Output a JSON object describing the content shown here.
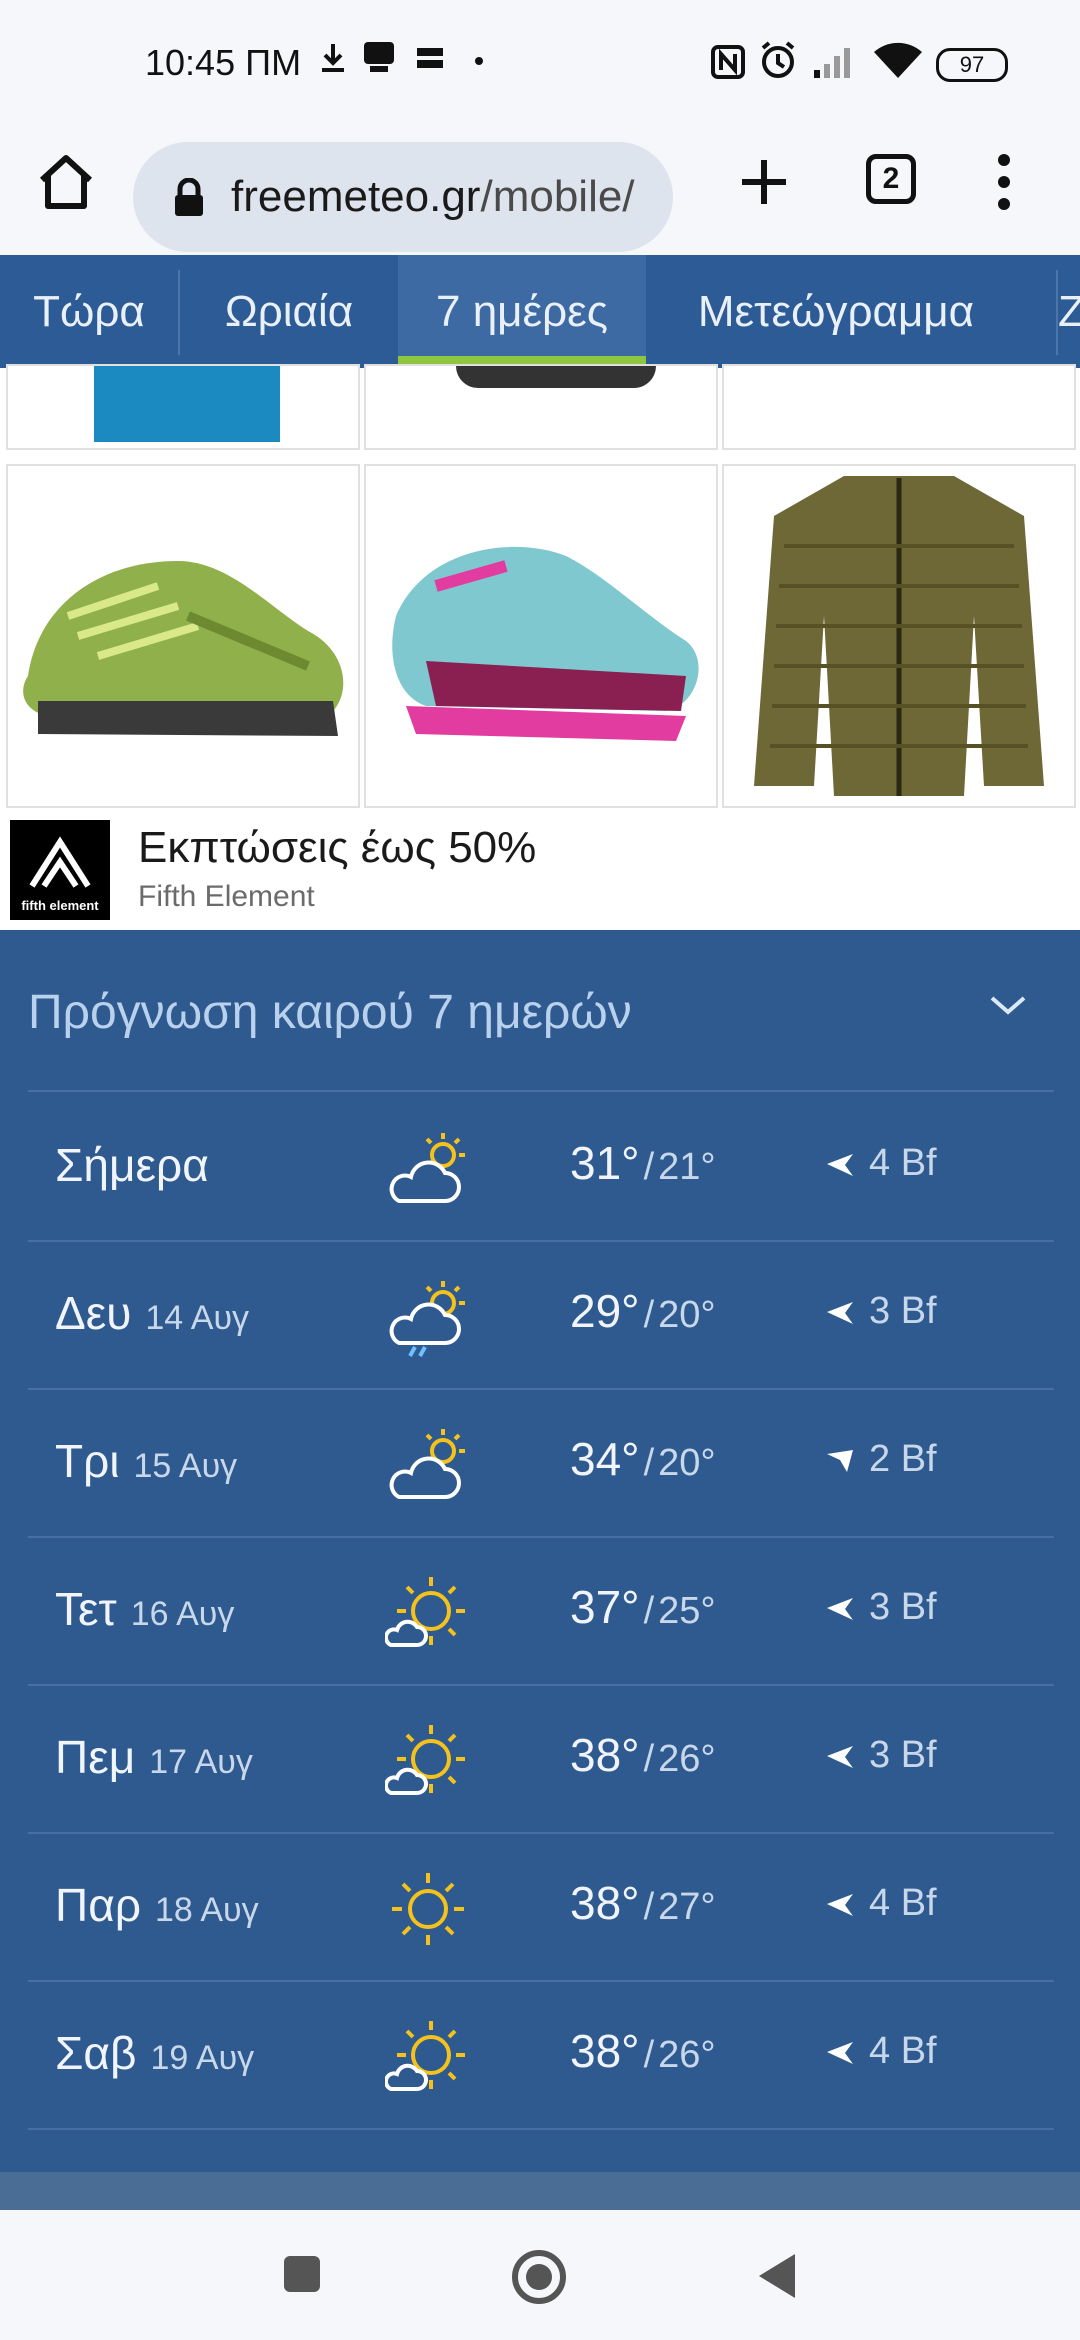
{
  "status_bar": {
    "time": "10:45 ΠΜ",
    "battery": "97"
  },
  "browser": {
    "url_domain": "freemeteo.gr",
    "url_path": "/mobile/",
    "tab_count": "2"
  },
  "nav_tabs": [
    {
      "label": "Τώρα"
    },
    {
      "label": "Ωριαία"
    },
    {
      "label": "7 ημέρες",
      "active": true
    },
    {
      "label": "Μετεώγραμμα"
    },
    {
      "label": "Ζ"
    }
  ],
  "ad": {
    "title": "Εκπτώσεις έως 50%",
    "advertiser": "Fifth Element",
    "logo_text": "fifth element"
  },
  "forecast": {
    "title": "Πρόγνωση καιρού 7 ημερών",
    "days": [
      {
        "day": "Σήμερα",
        "date": "",
        "icon": "partly-cloudy-icon",
        "max": "31°",
        "min": "21°",
        "wind": "4 Bf"
      },
      {
        "day": "Δευ",
        "date": "14 Αυγ",
        "icon": "cloud-rain-sun-icon",
        "max": "29°",
        "min": "20°",
        "wind": "3 Bf"
      },
      {
        "day": "Τρι",
        "date": "15 Αυγ",
        "icon": "partly-cloudy-icon",
        "max": "34°",
        "min": "20°",
        "wind": "2 Bf"
      },
      {
        "day": "Τετ",
        "date": "16 Αυγ",
        "icon": "mostly-sunny-icon",
        "max": "37°",
        "min": "25°",
        "wind": "3 Bf"
      },
      {
        "day": "Πεμ",
        "date": "17 Αυγ",
        "icon": "mostly-sunny-icon",
        "max": "38°",
        "min": "26°",
        "wind": "3 Bf"
      },
      {
        "day": "Παρ",
        "date": "18 Αυγ",
        "icon": "sun-icon",
        "max": "38°",
        "min": "27°",
        "wind": "4 Bf"
      },
      {
        "day": "Σαβ",
        "date": "19 Αυγ",
        "icon": "mostly-sunny-icon",
        "max": "38°",
        "min": "26°",
        "wind": "4 Bf"
      }
    ]
  },
  "colors": {
    "forecast_bg": "#2e5a8f",
    "nav_bg": "#2d5b95",
    "active_tab_underline": "#8dc63f",
    "sun": "#f5c21b"
  }
}
